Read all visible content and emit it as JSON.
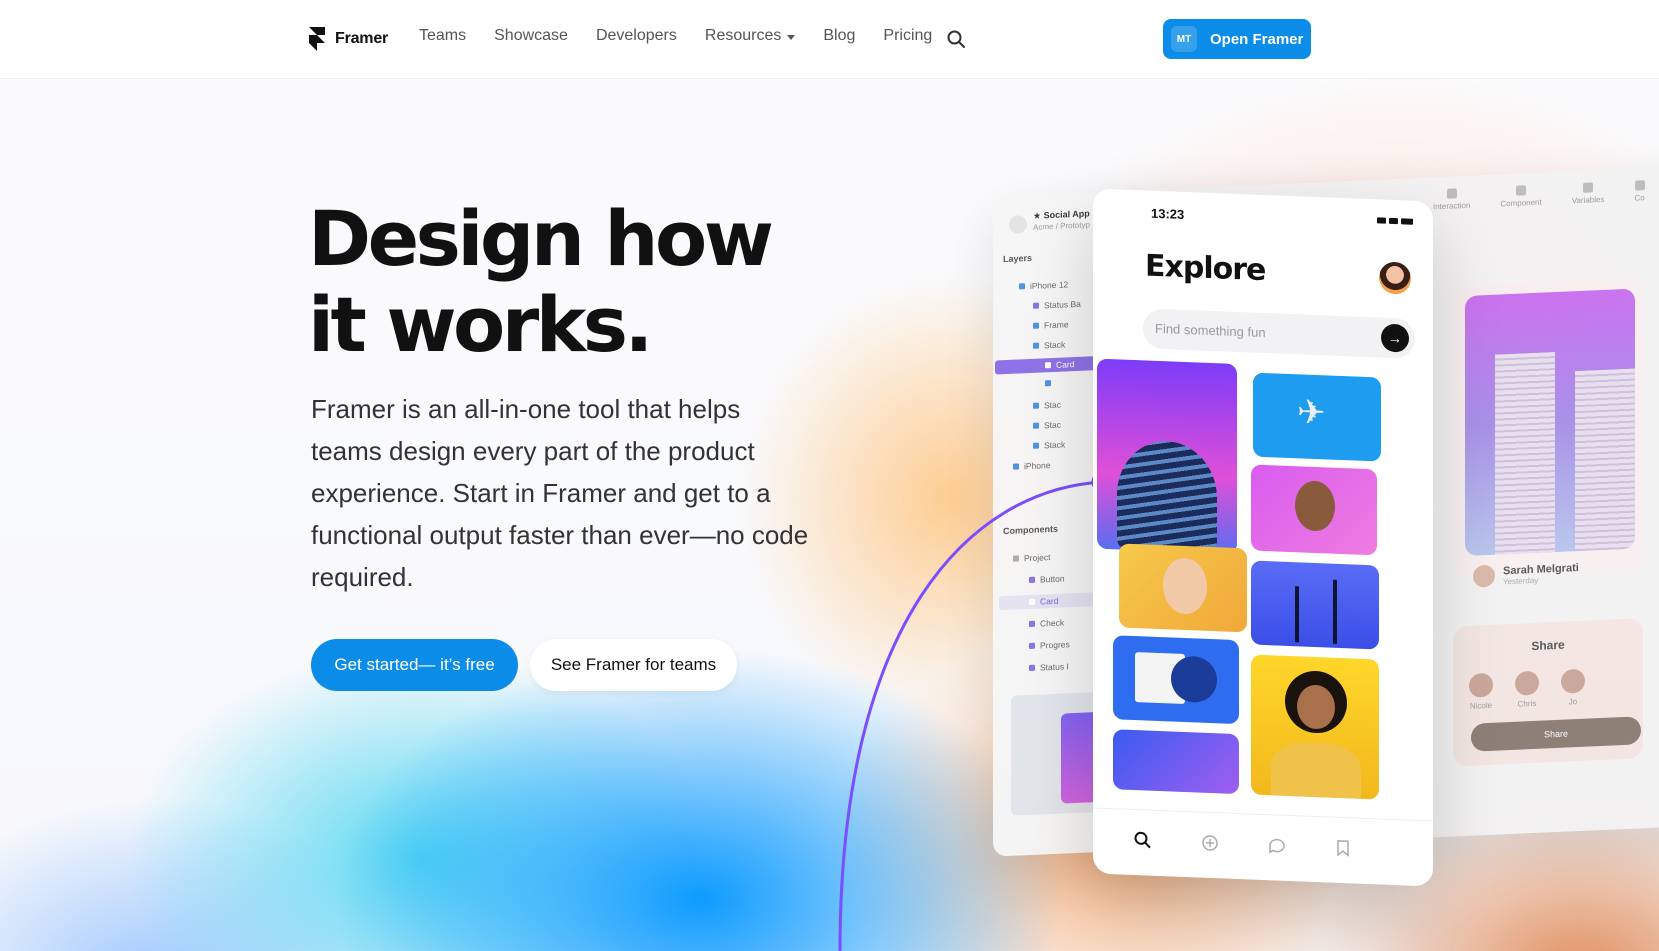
{
  "nav": {
    "logo_text": "Framer",
    "links": [
      {
        "label": "Teams"
      },
      {
        "label": "Showcase"
      },
      {
        "label": "Developers"
      },
      {
        "label": "Resources"
      },
      {
        "label": "Blog"
      },
      {
        "label": "Pricing"
      }
    ],
    "open_button": {
      "initials": "MT",
      "label": "Open Framer"
    }
  },
  "hero": {
    "headline_line1": "Design how",
    "headline_line2": "it works.",
    "description": "Framer is an all-in-one tool that helps teams design every part of the product experience. Start in Framer and get to a functional output faster than ever—no code required.",
    "primary_cta": "Get started— it’s free",
    "secondary_cta": "See Framer for teams"
  },
  "mockup": {
    "editor": {
      "project_name": "Social App",
      "project_path": "Acme / Prototyp",
      "layers_title": "Layers",
      "layers": [
        "iPhone 12",
        "Status Ba",
        "Frame",
        "Stack",
        "Card",
        "",
        "Stac",
        "Stac",
        "Stack",
        "iPhone"
      ],
      "components_title": "Components",
      "components": [
        "Project",
        "Button",
        "Card",
        "Check",
        "Progres",
        "Status I"
      ],
      "toolbar": [
        "Interaction",
        "Component",
        "Variables",
        "Co"
      ],
      "profile_name": "Sarah Melgrati",
      "profile_time": "Yesterday",
      "share_title": "Share",
      "share_people": [
        "Nicole",
        "Chris",
        "Jo"
      ],
      "share_button": "Share"
    },
    "phone": {
      "time": "13:23",
      "title": "Explore",
      "search_placeholder": "Find something fun"
    }
  },
  "colors": {
    "accent": "#0c8ce9",
    "selection": "#8a6ee8",
    "curve": "#7b4dff"
  }
}
